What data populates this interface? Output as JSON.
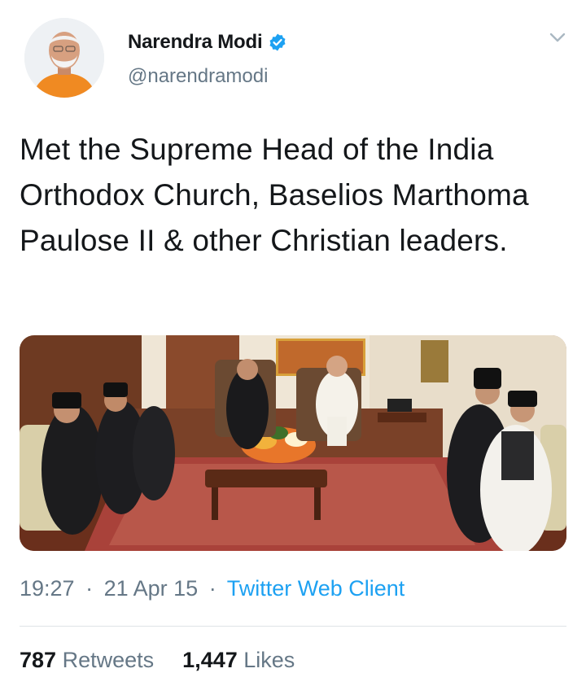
{
  "user": {
    "name": "Narendra Modi",
    "handle": "@narendramodi"
  },
  "tweet": {
    "text": "Met the Supreme Head of the India Orthodox Church, Baselios Marthoma Paulose II & other Christian leaders."
  },
  "meta": {
    "time": "19:27",
    "date": "21 Apr 15",
    "separator": "·",
    "client": "Twitter Web Client"
  },
  "stats": {
    "retweets_count": "787",
    "retweets_label": "Retweets",
    "likes_count": "1,447",
    "likes_label": "Likes"
  },
  "icons": {
    "verified": "verified-badge-icon",
    "more": "chevron-down-icon"
  },
  "colors": {
    "accent": "#1da1f2",
    "secondary_text": "#657786",
    "primary_text": "#14171a"
  }
}
